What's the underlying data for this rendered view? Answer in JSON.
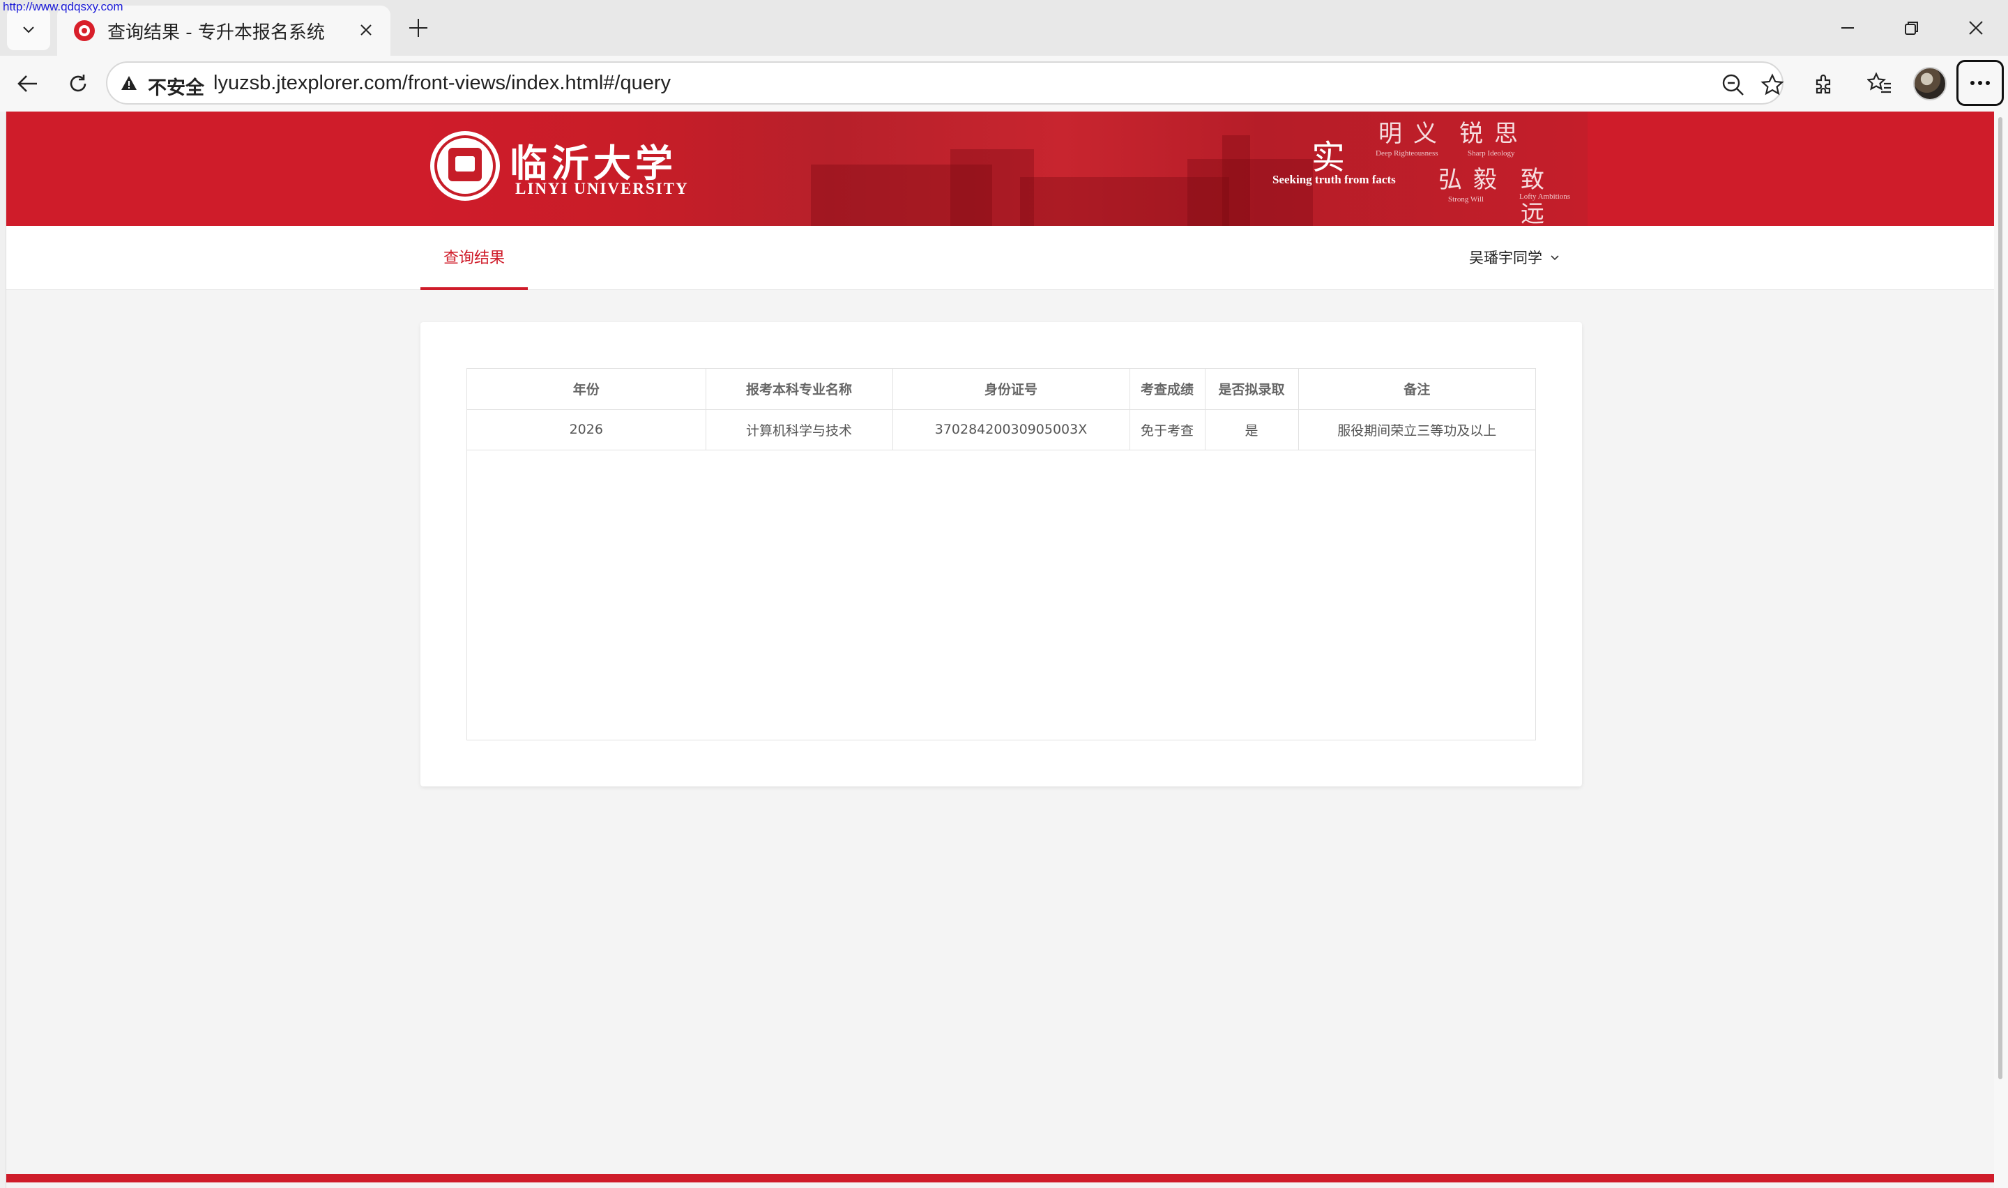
{
  "watermark": "http://www.qdqsxy.com",
  "browser": {
    "tab_title": "查询结果 - 专升本报名系统",
    "security_label": "不安全",
    "url": "lyuzsb.jtexplorer.com/front-views/index.html#/query"
  },
  "banner": {
    "logo_cn": "临沂大学",
    "logo_en": "LINYI UNIVERSITY",
    "motto_main": "实",
    "motto_main_en": "Seeking truth from facts",
    "motto_items": [
      {
        "cn": "明义",
        "en": "Deep Righteousness"
      },
      {
        "cn": "锐思",
        "en": "Sharp Ideology"
      },
      {
        "cn": "弘毅",
        "en": "Strong Will"
      },
      {
        "cn": "致远",
        "en": "Lofty Ambitions"
      }
    ]
  },
  "subnav": {
    "active_tab": "查询结果",
    "user": "吴璠宇同学"
  },
  "table": {
    "headers": [
      "年份",
      "报考本科专业名称",
      "身份证号",
      "考查成绩",
      "是否拟录取",
      "备注"
    ],
    "rows": [
      [
        "2026",
        "计算机科学与技术",
        "37028420030905003X",
        "免于考查",
        "是",
        "服役期间荣立三等功及以上"
      ]
    ]
  },
  "colors": {
    "brand_red": "#cf1c2a"
  }
}
